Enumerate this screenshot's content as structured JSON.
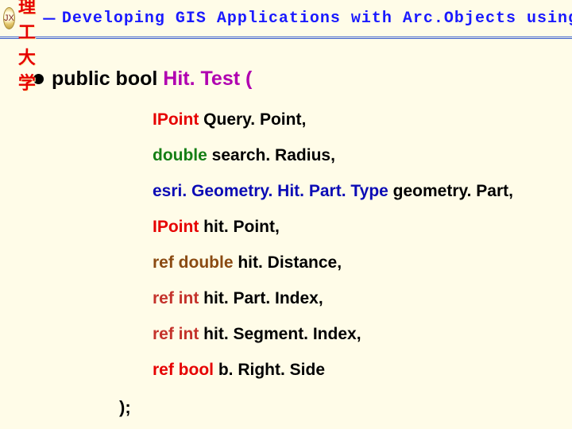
{
  "header": {
    "logo_text": "JX",
    "university": "江西理工大学",
    "separator": "－",
    "subtitle": "Developing GIS Applications with Arc.Objects using C#. NE"
  },
  "signature": {
    "modifiers": "public bool",
    "method_name": "Hit. Test",
    "open_paren": "("
  },
  "params": [
    {
      "type_class": "type-ipoint",
      "type": "IPoint",
      "name": "Query. Point,"
    },
    {
      "type_class": "type-double",
      "type": "double",
      "name": "search. Radius,"
    },
    {
      "type_class": "type-esri",
      "type": "esri. Geometry. Hit. Part. Type",
      "name": "geometry. Part,"
    },
    {
      "type_class": "type-ipoint",
      "type": "IPoint",
      "name": "hit. Point,"
    },
    {
      "type_class": "type-ref",
      "type": "ref double",
      "name": "hit. Distance,"
    },
    {
      "type_class": "type-refint",
      "type": "ref int",
      "name": "hit. Part. Index,"
    },
    {
      "type_class": "type-refint",
      "type": "ref int",
      "name": "hit. Segment. Index,"
    },
    {
      "type_class": "type-refbool",
      "type": "ref bool",
      "name": "b. Right. Side"
    }
  ],
  "closing": ");"
}
